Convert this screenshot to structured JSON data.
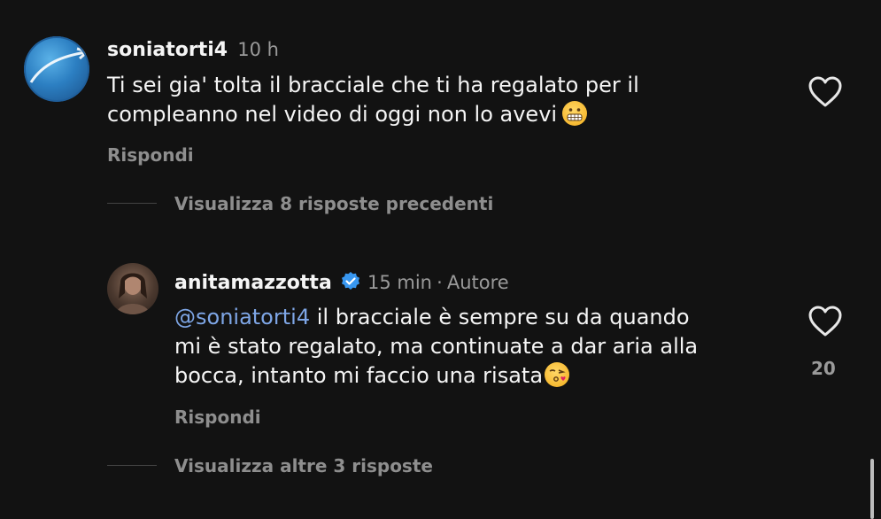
{
  "comments": [
    {
      "username": "soniatorti4",
      "time": "10 h",
      "text": "Ti sei gia' tolta il bracciale che ti ha regalato per il compleanno nel video di oggi non lo avevi",
      "text_line1": "Ti sei gia' tolta il bracciale che ti ha regalato per il",
      "text_line2": "compleanno nel video di oggi non lo avevi",
      "emoji": "grimacing-face",
      "reply_label": "Rispondi"
    }
  ],
  "thread": {
    "view_previous": "Visualizza 8 risposte precedenti",
    "reply": {
      "username": "anitamazzotta",
      "verified": true,
      "time": "15 min",
      "separator": "·",
      "author_tag": "Autore",
      "mention": "@soniatorti4",
      "text_line1": " il bracciale è sempre su da quando",
      "text_line2": "mi è stato regalato, ma continuate a dar aria alla",
      "text_line3": "bocca, intanto mi faccio una risata",
      "emoji": "face-blowing-a-kiss",
      "like_count": "20",
      "reply_label": "Rispondi"
    },
    "view_more": "Visualizza altre 3 risposte"
  },
  "colors": {
    "background": "#121212",
    "mention": "#7ea6e6",
    "verified": "#3897f0",
    "secondary_text": "#8e8e8e"
  }
}
